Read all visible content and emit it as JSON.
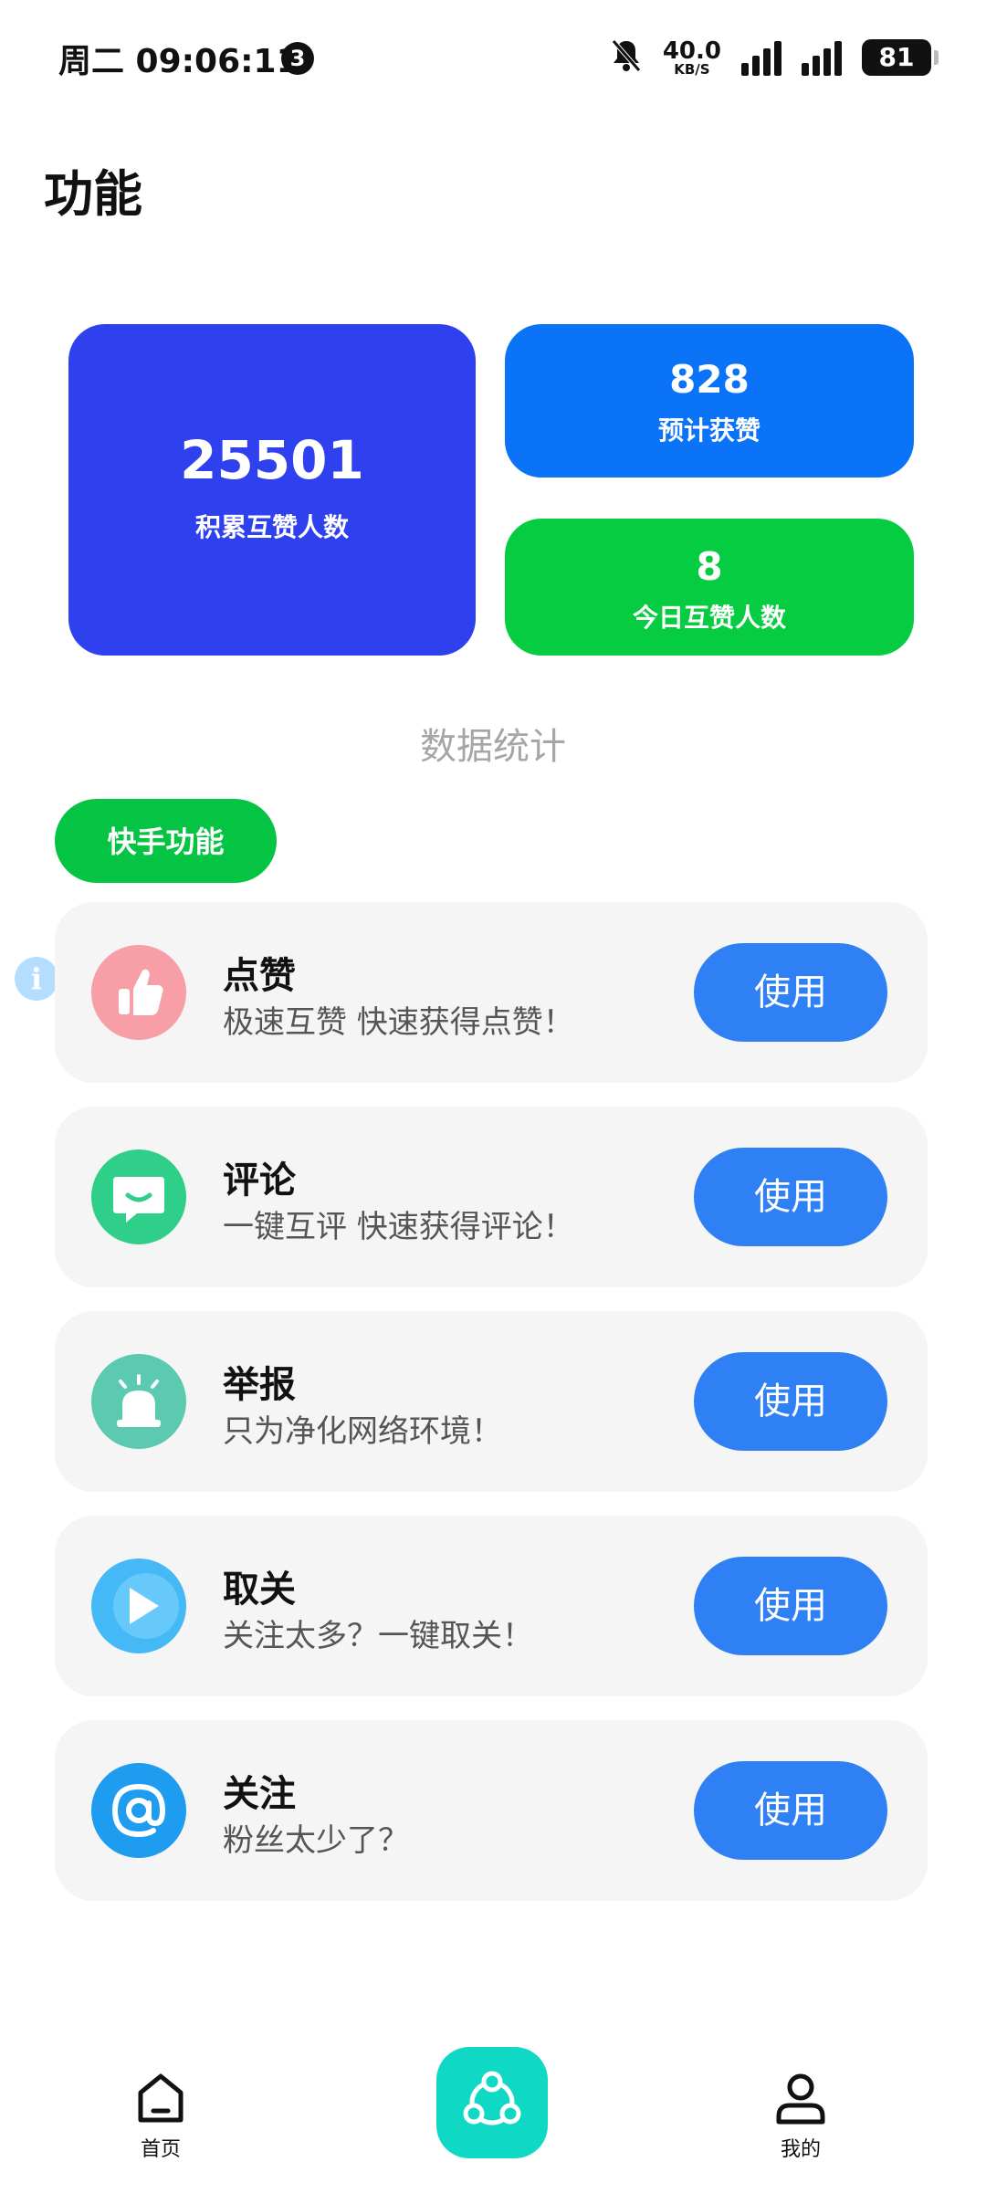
{
  "status_bar": {
    "time": "周二 09:06:11",
    "notification_count": "3",
    "net_speed_value": "40.0",
    "net_speed_unit": "KB/S",
    "battery": "81"
  },
  "page": {
    "title": "功能"
  },
  "stats": {
    "total": {
      "value": "25501",
      "label": "积累互赞人数"
    },
    "estimated": {
      "value": "828",
      "label": "预计获赞"
    },
    "today": {
      "value": "8",
      "label": "今日互赞人数"
    }
  },
  "section_caption": "数据统计",
  "feature_tab": "快手功能",
  "features": [
    {
      "title": "点赞",
      "desc": "极速互赞 快速获得点赞！",
      "button": "使用",
      "icon": "thumbs-up-icon",
      "color": "#f89ea6"
    },
    {
      "title": "评论",
      "desc": "一键互评 快速获得评论！",
      "button": "使用",
      "icon": "comment-icon",
      "color": "#2fcf8a"
    },
    {
      "title": "举报",
      "desc": "只为净化网络环境！",
      "button": "使用",
      "icon": "alarm-icon",
      "color": "#5ccab0"
    },
    {
      "title": "取关",
      "desc": "关注太多？一键取关！",
      "button": "使用",
      "icon": "play-icon",
      "color": "#45b9f5"
    },
    {
      "title": "关注",
      "desc": "粉丝太少了？",
      "button": "使用",
      "icon": "at-icon",
      "color": "#1e9cf0"
    }
  ],
  "nav": {
    "home_label": "首页",
    "mine_label": "我的"
  },
  "colors": {
    "stat_total": "#2f41ef",
    "stat_estimated": "#0a73f7",
    "stat_today": "#05cc40",
    "use_button": "#2f80f4",
    "nav_center": "#0fd9c5"
  }
}
